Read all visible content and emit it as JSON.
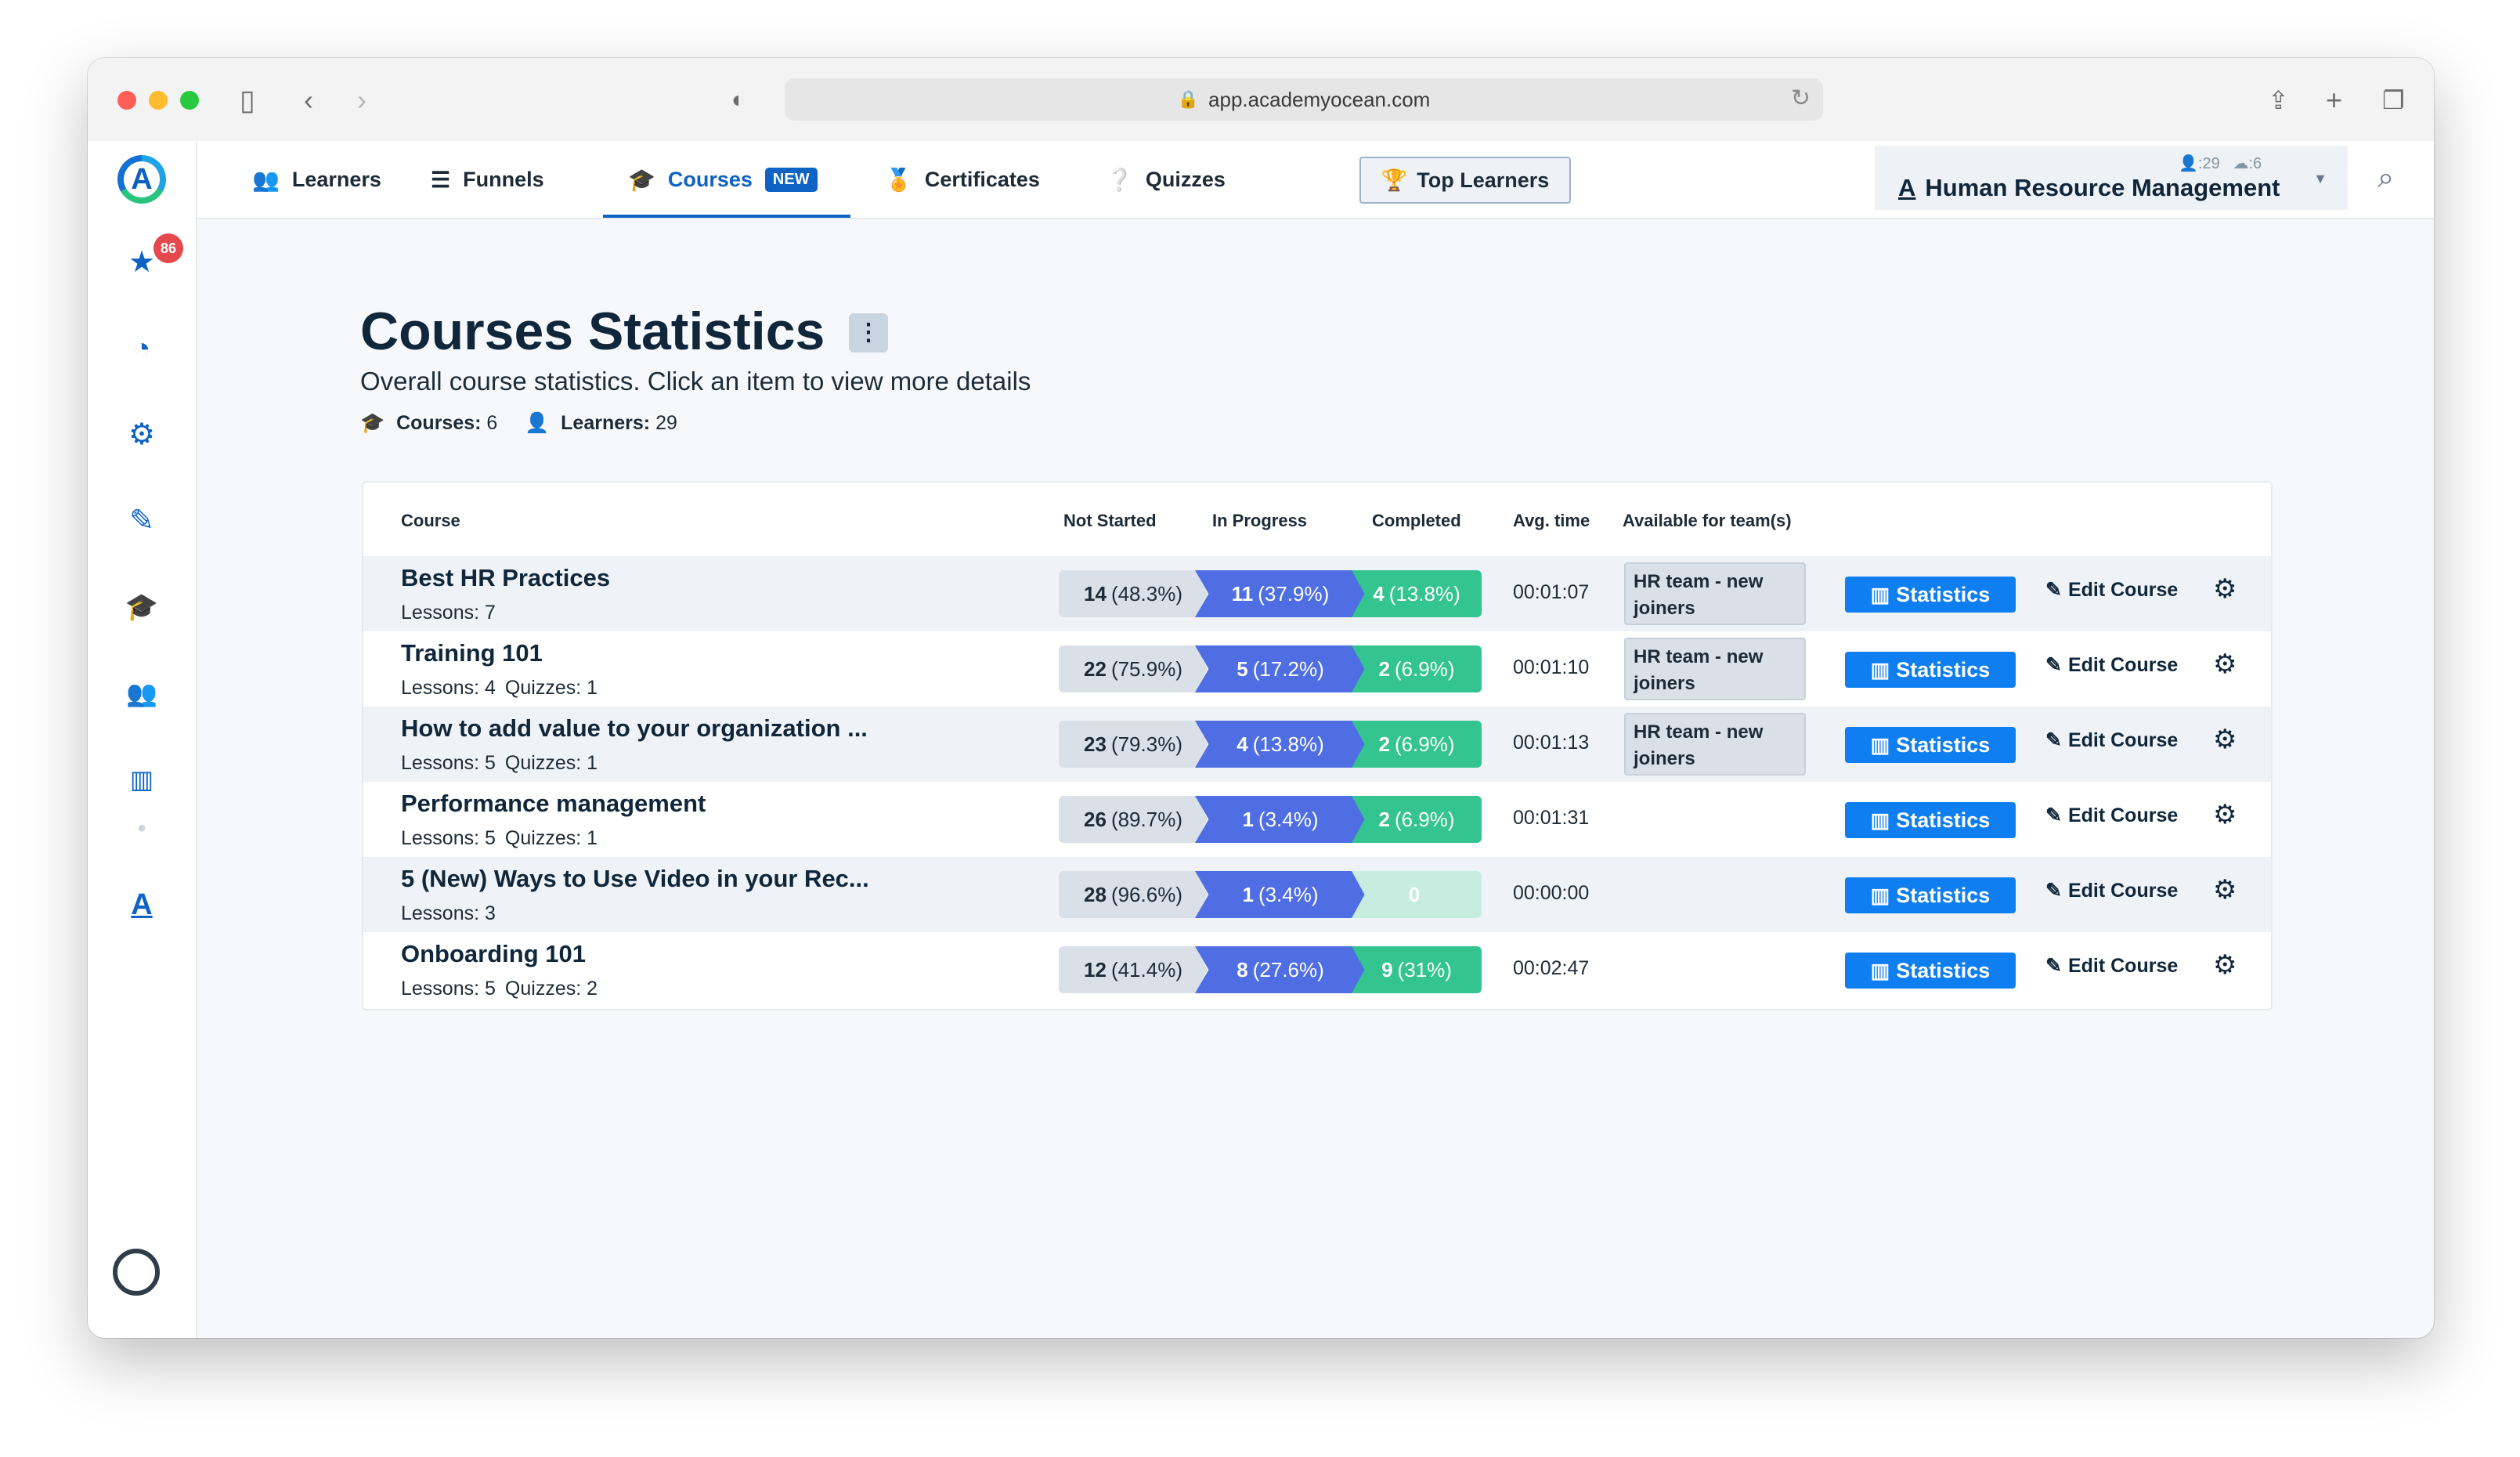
{
  "browser": {
    "url": "app.academyocean.com"
  },
  "sidebar": {
    "logo_letter": "A",
    "notification_count": "86",
    "items": [
      {
        "name": "favorites-star-icon",
        "glyph": "★"
      },
      {
        "name": "dashboard-gauge-icon",
        "glyph": "◔"
      },
      {
        "name": "settings-gear-icon",
        "glyph": "⚙"
      },
      {
        "name": "design-brush-icon",
        "glyph": "✎"
      },
      {
        "name": "academy-graduation-cap-icon",
        "glyph": "🎓"
      },
      {
        "name": "team-users-icon",
        "glyph": "👥"
      },
      {
        "name": "reports-bar-chart-icon",
        "glyph": "📊"
      }
    ],
    "bottom_letter": "A"
  },
  "topnav": {
    "learners": "Learners",
    "funnels": "Funnels",
    "courses": "Courses",
    "new_badge": "NEW",
    "certificates": "Certificates",
    "quizzes": "Quizzes",
    "top_learners": "Top Learners",
    "org": {
      "learners_count": "29",
      "groups_count": "6",
      "name": "Human Resource Management"
    }
  },
  "page": {
    "title": "Courses Statistics",
    "subtitle": "Overall course statistics. Click an item to view more details",
    "courses_label": "Courses:",
    "courses_count": "6",
    "learners_label": "Learners:",
    "learners_count": "29"
  },
  "table": {
    "headers": {
      "course": "Course",
      "not_started": "Not Started",
      "in_progress": "In Progress",
      "completed": "Completed",
      "avg_time": "Avg. time",
      "teams": "Available for team(s)"
    },
    "statistics_label": "Statistics",
    "edit_label": "Edit Course",
    "rows": [
      {
        "name": "Best HR Practices",
        "lessons": "Lessons: 7",
        "quizzes": "",
        "ns_n": "14",
        "ns_p": "(48.3%)",
        "ip_n": "11",
        "ip_p": "(37.9%)",
        "cp_n": "4",
        "cp_p": "(13.8%)",
        "avg": "00:01:07",
        "team": "HR team - new joiners"
      },
      {
        "name": "Training 101",
        "lessons": "Lessons: 4",
        "quizzes": "Quizzes: 1",
        "ns_n": "22",
        "ns_p": "(75.9%)",
        "ip_n": "5",
        "ip_p": "(17.2%)",
        "cp_n": "2",
        "cp_p": "(6.9%)",
        "avg": "00:01:10",
        "team": "HR team - new joiners"
      },
      {
        "name": "How to add value to your organization ...",
        "lessons": "Lessons: 5",
        "quizzes": "Quizzes: 1",
        "ns_n": "23",
        "ns_p": "(79.3%)",
        "ip_n": "4",
        "ip_p": "(13.8%)",
        "cp_n": "2",
        "cp_p": "(6.9%)",
        "avg": "00:01:13",
        "team": "HR team - new joiners"
      },
      {
        "name": "Performance management",
        "lessons": "Lessons: 5",
        "quizzes": "Quizzes: 1",
        "ns_n": "26",
        "ns_p": "(89.7%)",
        "ip_n": "1",
        "ip_p": "(3.4%)",
        "cp_n": "2",
        "cp_p": "(6.9%)",
        "avg": "00:01:31",
        "team": ""
      },
      {
        "name": "5 (New) Ways to Use Video in your Rec...",
        "lessons": "Lessons: 3",
        "quizzes": "",
        "ns_n": "28",
        "ns_p": "(96.6%)",
        "ip_n": "1",
        "ip_p": "(3.4%)",
        "cp_n": "0",
        "cp_p": "",
        "avg": "00:00:00",
        "team": ""
      },
      {
        "name": "Onboarding 101",
        "lessons": "Lessons: 5",
        "quizzes": "Quizzes: 2",
        "ns_n": "12",
        "ns_p": "(41.4%)",
        "ip_n": "8",
        "ip_p": "(27.6%)",
        "cp_n": "9",
        "cp_p": "(31%)",
        "avg": "00:02:47",
        "team": ""
      }
    ]
  }
}
